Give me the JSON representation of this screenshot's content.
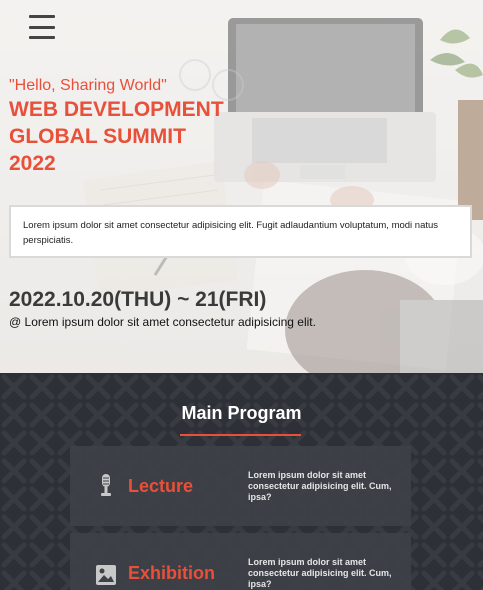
{
  "menu": {
    "icon": "hamburger-menu-icon"
  },
  "hero": {
    "tagline": "\"Hello, Sharing World\"",
    "title_lines": [
      "WEB DEVELOPMENT",
      "GLOBAL SUMMIT",
      "2022"
    ],
    "description": "Lorem ipsum dolor sit amet consectetur adipisicing elit. Fugit adlaudantium voluptatum, modi natus perspiciatis.",
    "date": "2022.10.20(THU) ~ 21(FRI)",
    "place": "@ Lorem ipsum dolor sit amet consectetur adipisicing elit."
  },
  "program": {
    "title": "Main Program",
    "items": [
      {
        "icon": "microphone-icon",
        "name": "Lecture",
        "desc": "Lorem ipsum dolor sit amet consectetur adipisicing elit. Cum, ipsa?"
      },
      {
        "icon": "image-icon",
        "name": "Exhibition",
        "desc": "Lorem ipsum dolor sit amet consectetur adipisicing elit. Cum, ipsa?"
      }
    ]
  },
  "colors": {
    "accent": "#e8503a",
    "dark_bg": "#2d3036",
    "card_bg": "#3e4148"
  }
}
